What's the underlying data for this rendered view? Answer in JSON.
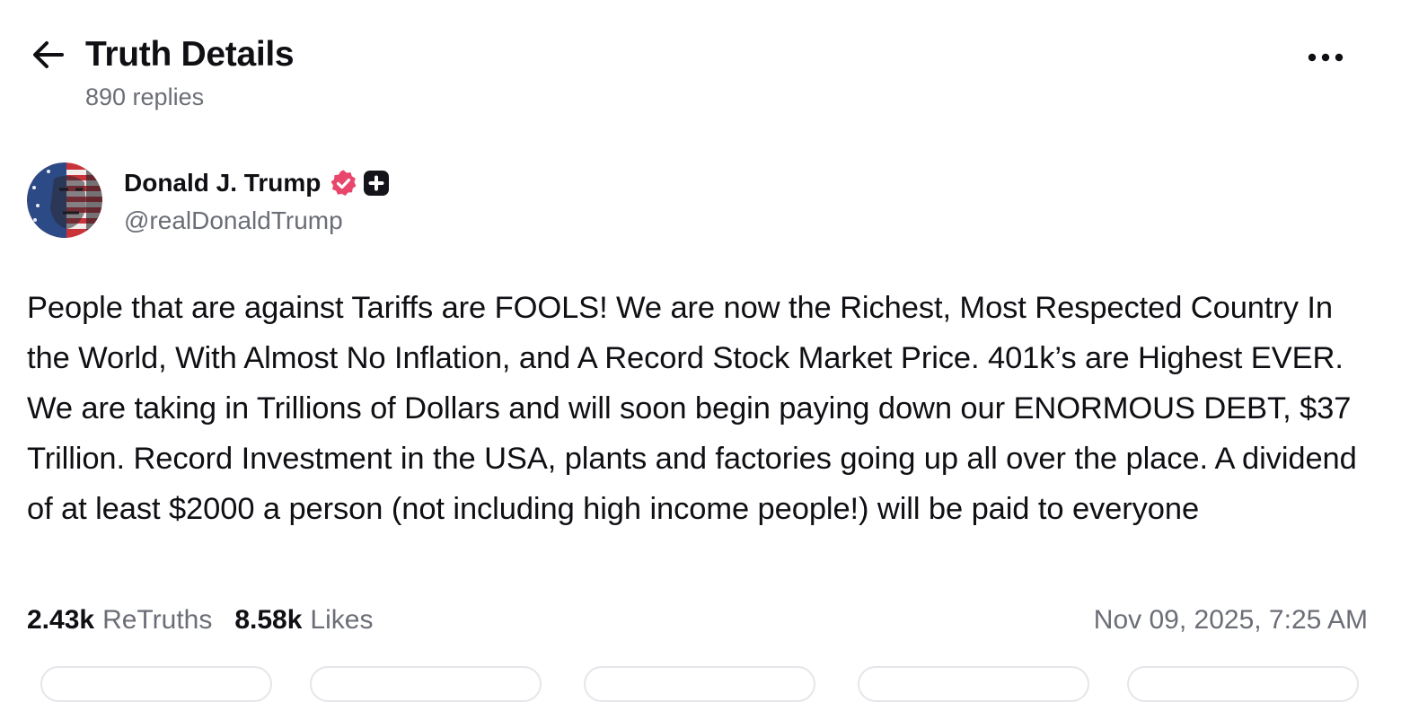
{
  "header": {
    "title": "Truth Details",
    "replies_text": "890 replies"
  },
  "author": {
    "display_name": "Donald J. Trump",
    "handle": "@realDonaldTrump",
    "verified_color": "#e8476b"
  },
  "post": {
    "text": "People that are against Tariffs are FOOLS! We are now the Richest, Most Respected Country In the World, With Almost No Inflation, and A Record Stock Market Price. 401k’s are Highest EVER. We are taking in Trillions of Dollars and will soon begin paying down our ENORMOUS DEBT, $37 Trillion. Record Investment in the USA, plants and factories going up all over the place. A dividend of at least $2000 a person (not including high income people!) will be paid to everyone"
  },
  "stats": {
    "retruths_count": "2.43k",
    "retruths_label": "ReTruths",
    "likes_count": "8.58k",
    "likes_label": "Likes",
    "timestamp": "Nov 09, 2025, 7:25 AM"
  },
  "icons": {
    "back": "arrow-left-icon",
    "more": "more-horizontal-icon",
    "verified": "verified-badge-icon",
    "plus": "plus-badge-icon"
  },
  "colors": {
    "text_primary": "#0f0f14",
    "text_secondary": "#6b6e76"
  }
}
